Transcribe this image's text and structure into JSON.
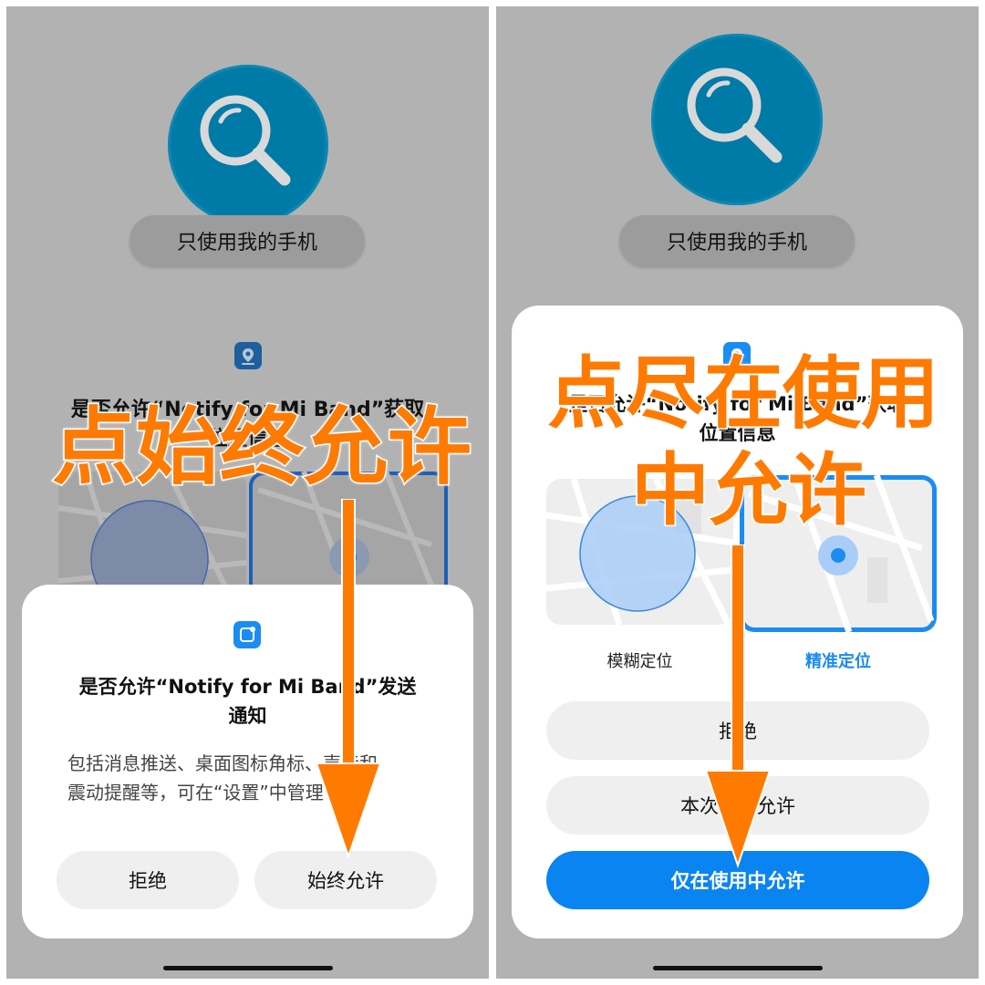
{
  "left_panel": {
    "only_phone_label": "只使用我的手机",
    "location_dialog_title_line1": "是否允许“Notify for Mi Band”获取",
    "location_dialog_title_line2": "位置信息",
    "notification_dialog": {
      "title_line1": "是否允许“Notify for Mi Band”发送",
      "title_line2": "通知",
      "body_line1": "包括消息推送、桌面图标角标、声音和",
      "body_line2": "震动提醒等，可在“设置”中管理",
      "deny_label": "拒绝",
      "always_allow_label": "始终允许"
    },
    "overlay_instruction": "点始终允许"
  },
  "right_panel": {
    "only_phone_label": "只使用我的手机",
    "location_dialog": {
      "title_line1": "是否允许“Notify for Mi Band”获取",
      "title_line2": "位置信息",
      "approximate_label": "模糊定位",
      "precise_label": "精准定位",
      "deny_label": "拒绝",
      "allow_once_label": "本次运行允许",
      "allow_while_using_label": "仅在使用中允许"
    },
    "overlay_instruction_line1": "点尽在使用",
    "overlay_instruction_line2": "中允许"
  },
  "colors": {
    "accent_blue": "#0a84f0",
    "overlay_orange": "#ff7a00",
    "search_teal": "#007aa6"
  },
  "icons": [
    "search-icon",
    "location-permission-icon",
    "notification-permission-icon",
    "arrow-down-icon"
  ]
}
